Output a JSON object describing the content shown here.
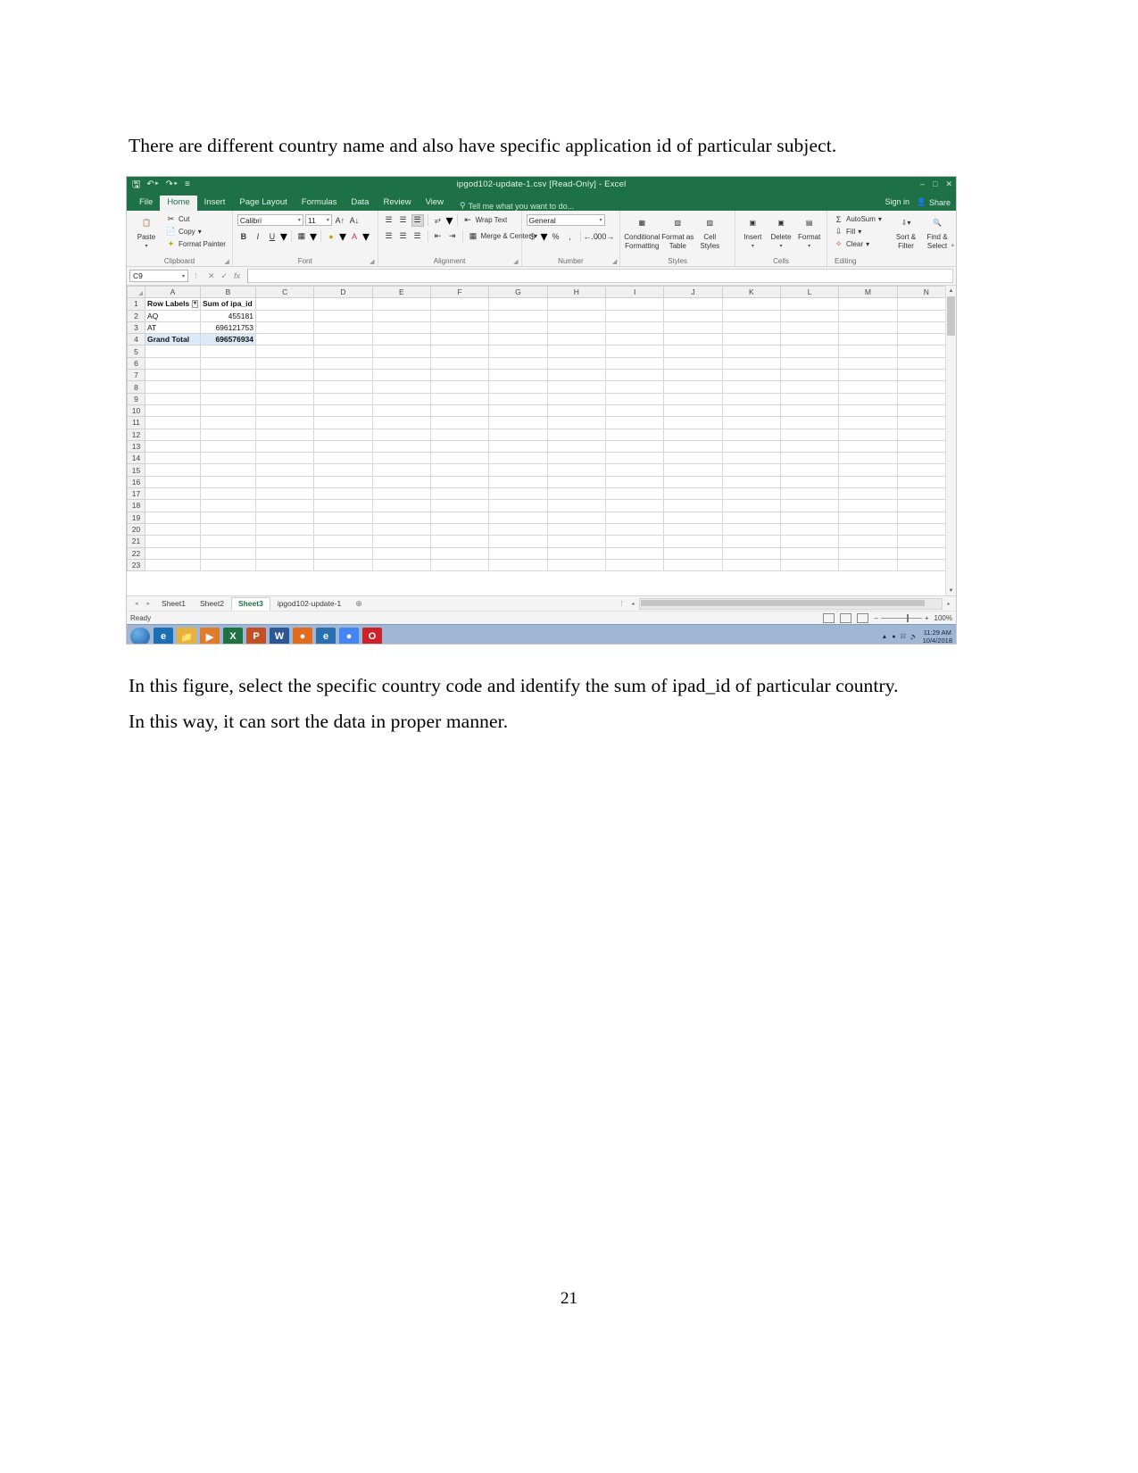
{
  "document": {
    "paragraph_intro": "There are different country name and also have specific application id of particular subject.",
    "paragraph_after": "In this figure, select the specific country code and identify the sum of ipad_id of particular country. In this way, it can sort the data in proper manner.",
    "page_number": "21"
  },
  "excel": {
    "window_title": "ipgod102-update-1.csv  [Read-Only] - Excel",
    "quick_access": {
      "save_icon": "save-icon",
      "undo_icon": "undo-icon",
      "redo_icon": "redo-icon",
      "customize_icon": "customize-quick-access-icon"
    },
    "window_buttons": {
      "help": "?",
      "minimize": "–",
      "restore": "□",
      "close": "✕"
    },
    "tabs": [
      {
        "label": "File",
        "active": false
      },
      {
        "label": "Home",
        "active": true
      },
      {
        "label": "Insert",
        "active": false
      },
      {
        "label": "Page Layout",
        "active": false
      },
      {
        "label": "Formulas",
        "active": false
      },
      {
        "label": "Data",
        "active": false
      },
      {
        "label": "Review",
        "active": false
      },
      {
        "label": "View",
        "active": false
      }
    ],
    "tell_me": "Tell me what you want to do...",
    "sign_in": "Sign in",
    "share": "Share",
    "ribbon": {
      "clipboard": {
        "group": "Clipboard",
        "paste": "Paste",
        "cut": "Cut",
        "copy": "Copy",
        "format_painter": "Format Painter"
      },
      "font": {
        "group": "Font",
        "font_name": "Calibri",
        "font_size": "11",
        "grow_font": "A",
        "shrink_font": "A",
        "bold": "B",
        "italic": "I",
        "underline": "U"
      },
      "alignment": {
        "group": "Alignment",
        "wrap_text": "Wrap Text",
        "merge_center": "Merge & Center"
      },
      "number": {
        "group": "Number",
        "format": "General",
        "currency": "$",
        "percent": "%",
        "comma": ","
      },
      "styles": {
        "group": "Styles",
        "conditional_formatting": "Conditional Formatting",
        "format_as_table": "Format as Table",
        "cell_styles": "Cell Styles"
      },
      "cells": {
        "group": "Cells",
        "insert": "Insert",
        "delete": "Delete",
        "format": "Format"
      },
      "editing": {
        "group": "Editing",
        "autosum": "AutoSum",
        "fill": "Fill",
        "clear": "Clear",
        "sort_filter": "Sort & Filter",
        "find_select": "Find & Select"
      }
    },
    "formula_bar": {
      "name_box": "C9",
      "cancel_icon": "cancel-icon",
      "enter_icon": "confirm-icon",
      "function_icon": "insert-function-icon",
      "formula_value": ""
    },
    "sheet": {
      "column_headers": [
        "A",
        "B",
        "C",
        "D",
        "E",
        "F",
        "G",
        "H",
        "I",
        "J",
        "K",
        "L",
        "M",
        "N"
      ],
      "row_count": 23,
      "data": [
        {
          "row": "1",
          "a": "Row Labels",
          "b": "Sum of ipa_id",
          "style": "header",
          "filter": true
        },
        {
          "row": "2",
          "a": "AQ",
          "b": "455181",
          "style": "data"
        },
        {
          "row": "3",
          "a": "AT",
          "b": "696121753",
          "style": "data"
        },
        {
          "row": "4",
          "a": "Grand Total",
          "b": "696576934",
          "style": "total"
        }
      ]
    },
    "sheet_tabs": [
      {
        "label": "Sheet1",
        "active": false
      },
      {
        "label": "Sheet2",
        "active": false
      },
      {
        "label": "Sheet3",
        "active": true
      },
      {
        "label": "ipgod102-update-1",
        "active": false
      }
    ],
    "new_sheet_icon": "add-sheet-icon",
    "status_bar": {
      "status": "Ready",
      "zoom": "100%",
      "view_normal_icon": "normal-view-icon",
      "view_page_layout_icon": "page-layout-view-icon",
      "view_page_break_icon": "page-break-view-icon",
      "zoom_out": "–",
      "zoom_in": "+"
    },
    "taskbar": {
      "apps": [
        {
          "name": "start-button",
          "glyph": ""
        },
        {
          "name": "internet-explorer-icon",
          "glyph": "e",
          "color": "#1a6fb5"
        },
        {
          "name": "file-explorer-icon",
          "glyph": "▮",
          "color": "#e8b23a"
        },
        {
          "name": "media-player-icon",
          "glyph": "▶",
          "color": "#e07b2a"
        },
        {
          "name": "excel-icon",
          "glyph": "X",
          "color": "#1e7145"
        },
        {
          "name": "powerpoint-icon",
          "glyph": "P",
          "color": "#c34f26"
        },
        {
          "name": "word-icon",
          "glyph": "W",
          "color": "#2b5797"
        },
        {
          "name": "firefox-icon",
          "glyph": "●",
          "color": "#e36b1e"
        },
        {
          "name": "edge-icon",
          "glyph": "e",
          "color": "#2a6fb0"
        },
        {
          "name": "chrome-icon",
          "glyph": "●",
          "color": "#4285f4"
        },
        {
          "name": "opera-icon",
          "glyph": "O",
          "color": "#cc2229"
        }
      ],
      "clock_time": "11:29 AM",
      "clock_date": "10/4/2018"
    }
  }
}
